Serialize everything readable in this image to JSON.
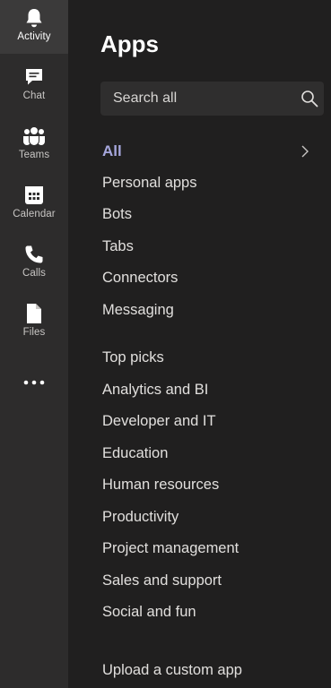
{
  "rail": {
    "items": [
      {
        "label": "Activity",
        "icon": "bell-icon"
      },
      {
        "label": "Chat",
        "icon": "chat-icon"
      },
      {
        "label": "Teams",
        "icon": "teams-icon"
      },
      {
        "label": "Calendar",
        "icon": "calendar-icon"
      },
      {
        "label": "Calls",
        "icon": "phone-icon"
      },
      {
        "label": "Files",
        "icon": "file-icon"
      }
    ],
    "more_icon": "more-icon"
  },
  "page": {
    "title": "Apps"
  },
  "search": {
    "placeholder": "Search all",
    "icon": "search-icon"
  },
  "nav": {
    "categories": [
      {
        "label": "All"
      },
      {
        "label": "Personal apps"
      },
      {
        "label": "Bots"
      },
      {
        "label": "Tabs"
      },
      {
        "label": "Connectors"
      },
      {
        "label": "Messaging"
      }
    ],
    "topics": [
      {
        "label": "Top picks"
      },
      {
        "label": "Analytics and BI"
      },
      {
        "label": "Developer and IT"
      },
      {
        "label": "Education"
      },
      {
        "label": "Human resources"
      },
      {
        "label": "Productivity"
      },
      {
        "label": "Project management"
      },
      {
        "label": "Sales and support"
      },
      {
        "label": "Social and fun"
      }
    ],
    "upload_label": "Upload a custom app"
  },
  "colors": {
    "accent": "#a6a7dc",
    "rail_bg": "#2d2c2c",
    "panel_bg": "#201f1f"
  }
}
